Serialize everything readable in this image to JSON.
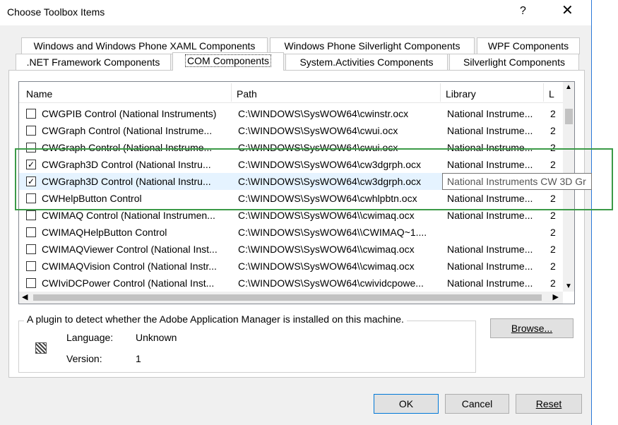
{
  "window": {
    "title": "Choose Toolbox Items",
    "help": "?",
    "close": "✕"
  },
  "tabs_row1": [
    "Windows and Windows Phone XAML Components",
    "Windows Phone Silverlight Components",
    "WPF Components"
  ],
  "tabs_row2": [
    ".NET Framework Components",
    "COM Components",
    "System.Activities Components",
    "Silverlight Components"
  ],
  "columns": {
    "name": "Name",
    "path": "Path",
    "library": "Library",
    "last": "L"
  },
  "rows": [
    {
      "checked": false,
      "name": "CWGPIB Control (National Instruments)",
      "path": "C:\\WINDOWS\\SysWOW64\\cwinstr.ocx",
      "library": "National Instrume...",
      "l": "2"
    },
    {
      "checked": false,
      "name": "CWGraph Control  (National Instrume...",
      "path": "C:\\WINDOWS\\SysWOW64\\cwui.ocx",
      "library": "National Instrume...",
      "l": "2"
    },
    {
      "checked": false,
      "name": "CWGraph Control  (National Instrume...",
      "path": "C:\\WINDOWS\\SysWOW64\\cwui.ocx",
      "library": "National Instrume...",
      "l": "2"
    },
    {
      "checked": true,
      "name": "CWGraph3D Control  (National Instru...",
      "path": "C:\\WINDOWS\\SysWOW64\\cw3dgrph.ocx",
      "library": "National Instrume...",
      "l": "2"
    },
    {
      "checked": true,
      "name": "CWGraph3D Control  (National Instru...",
      "path": "C:\\WINDOWS\\SysWOW64\\cw3dgrph.ocx",
      "library": "",
      "l": ""
    },
    {
      "checked": false,
      "name": "CWHelpButton Control",
      "path": "C:\\WINDOWS\\SysWOW64\\cwhlpbtn.ocx",
      "library": "National Instrume...",
      "l": "2"
    },
    {
      "checked": false,
      "name": "CWIMAQ Control (National Instrumen...",
      "path": "C:\\WINDOWS\\SysWOW64\\\\cwimaq.ocx",
      "library": "National Instrume...",
      "l": "2"
    },
    {
      "checked": false,
      "name": "CWIMAQHelpButton Control",
      "path": "C:\\WINDOWS\\SysWOW64\\\\CWIMAQ~1....",
      "library": "",
      "l": "2"
    },
    {
      "checked": false,
      "name": "CWIMAQViewer Control (National Inst...",
      "path": "C:\\WINDOWS\\SysWOW64\\\\cwimaq.ocx",
      "library": "National Instrume...",
      "l": "2"
    },
    {
      "checked": false,
      "name": "CWIMAQVision Control (National Instr...",
      "path": "C:\\WINDOWS\\SysWOW64\\\\cwimaq.ocx",
      "library": "National Instrume...",
      "l": "2"
    },
    {
      "checked": false,
      "name": "CWIviDCPower Control  (National Inst...",
      "path": "C:\\WINDOWS\\SysWOW64\\cwividcpowe...",
      "library": "National Instrume...",
      "l": "2"
    }
  ],
  "tooltip": "National Instruments CW 3D Gr",
  "scroll": {
    "up": "▲",
    "down": "▼",
    "left": "◀",
    "right": "▶"
  },
  "info": {
    "description": "A plugin to detect whether the Adobe Application Manager is installed on this machine.",
    "language_label": "Language:",
    "language_value": "Unknown",
    "version_label": "Version:",
    "version_value": "1"
  },
  "buttons": {
    "browse": "Browse...",
    "ok": "OK",
    "cancel": "Cancel",
    "reset": "Reset"
  },
  "colors": {
    "selection": "#e5f3ff",
    "annotation": "#3b9a47",
    "accent": "#0078d7"
  }
}
